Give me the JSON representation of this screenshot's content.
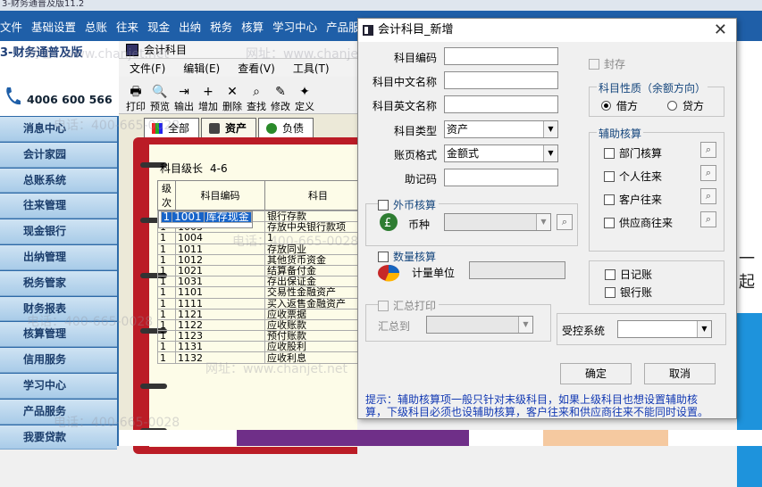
{
  "app": {
    "title": "3-财务通普及版11.2"
  },
  "menubar": [
    "文件",
    "基础设置",
    "总账",
    "往来",
    "现金",
    "出纳",
    "税务",
    "核算",
    "学习中心",
    "产品服务",
    "工"
  ],
  "brand": {
    "name": "3-财务通普及版",
    "phone": "4006 600 566"
  },
  "nav": [
    "消息中心",
    "会计家园",
    "总账系统",
    "往来管理",
    "现金银行",
    "出纳管理",
    "税务管家",
    "财务报表",
    "核算管理",
    "信用服务",
    "学习中心",
    "产品服务",
    "我要贷款"
  ],
  "bgwin": {
    "title": "会计科目",
    "menu": [
      "文件(F)",
      "编辑(E)",
      "查看(V)",
      "工具(T)"
    ],
    "toolbar": [
      {
        "label": "打印",
        "icon": "printer-icon",
        "glyph": "🖶"
      },
      {
        "label": "预览",
        "icon": "preview-icon",
        "glyph": "🔍"
      },
      {
        "label": "输出",
        "icon": "export-icon",
        "glyph": "⇥"
      },
      {
        "label": "增加",
        "icon": "add-icon",
        "glyph": "+"
      },
      {
        "label": "删除",
        "icon": "delete-icon",
        "glyph": "✕"
      },
      {
        "label": "查找",
        "icon": "find-icon",
        "glyph": "⌕"
      },
      {
        "label": "修改",
        "icon": "edit-icon",
        "glyph": "✎"
      },
      {
        "label": "定义",
        "icon": "define-icon",
        "glyph": "✦"
      }
    ],
    "tabs": [
      "全部",
      "资产",
      "负债"
    ],
    "level_label": "科目级长",
    "level_value": "4-6",
    "columns": [
      "级次",
      "科目编码",
      "科目"
    ],
    "rows": [
      {
        "lvl": "1",
        "code": "1001",
        "name": "库存现金",
        "selected": true
      },
      {
        "lvl": "1",
        "code": "1002",
        "name": "银行存款"
      },
      {
        "lvl": "1",
        "code": "1003",
        "name": "存放中央银行款项"
      },
      {
        "lvl": "1",
        "code": "1004",
        "name": "1"
      },
      {
        "lvl": "1",
        "code": "1011",
        "name": "存放同业"
      },
      {
        "lvl": "1",
        "code": "1012",
        "name": "其他货币资金"
      },
      {
        "lvl": "1",
        "code": "1021",
        "name": "结算备付金"
      },
      {
        "lvl": "1",
        "code": "1031",
        "name": "存出保证金"
      },
      {
        "lvl": "1",
        "code": "1101",
        "name": "交易性金融资产"
      },
      {
        "lvl": "1",
        "code": "1111",
        "name": "买入返售金融资产"
      },
      {
        "lvl": "1",
        "code": "1121",
        "name": "应收票据"
      },
      {
        "lvl": "1",
        "code": "1122",
        "name": "应收账款"
      },
      {
        "lvl": "1",
        "code": "1123",
        "name": "预付账款"
      },
      {
        "lvl": "1",
        "code": "1131",
        "name": "应收股利"
      },
      {
        "lvl": "1",
        "code": "1132",
        "name": "应收利息"
      }
    ]
  },
  "dialog": {
    "title": "会计科目_新增",
    "fields": {
      "code": {
        "label": "科目编码",
        "value": ""
      },
      "cn_name": {
        "label": "科目中文名称",
        "value": ""
      },
      "en_name": {
        "label": "科目英文名称",
        "value": ""
      },
      "type": {
        "label": "科目类型",
        "value": "资产"
      },
      "format": {
        "label": "账页格式",
        "value": "金额式"
      },
      "mnemonic": {
        "label": "助记码",
        "value": ""
      }
    },
    "sealed": "封存",
    "nature": {
      "legend": "科目性质（余额方向）",
      "debit": "借方",
      "credit": "贷方",
      "selected": "debit"
    },
    "aux": {
      "legend": "辅助核算",
      "items": [
        "部门核算",
        "个人往来",
        "客户往来",
        "供应商往来"
      ]
    },
    "journal": [
      "日记账",
      "银行账"
    ],
    "foreign": {
      "check": "外币核算",
      "currency_label": "币种",
      "currency_value": ""
    },
    "quantity": {
      "check": "数量核算",
      "unit_label": "计量单位",
      "unit_value": ""
    },
    "summary": {
      "check": "汇总打印",
      "to_label": "汇总到",
      "to_value": ""
    },
    "controlled": {
      "label": "受控系统",
      "value": ""
    },
    "ok": "确定",
    "cancel": "取消",
    "hint": "提示：辅助核算项一般只针对末级科目，如果上级科目也想设置辅助核算，下级科目必须也设辅助核算，客户往来和供应商往来不能同时设置。"
  },
  "bg_right": {
    "text": "一起"
  },
  "watermark": {
    "phone": "电话：400-665-0028",
    "url": "网址：www.chanjet.net"
  },
  "colors": {
    "menubar": "#1f5fa8",
    "nav": "#2d6aa8",
    "selection": "#1663c8",
    "notebook": "#bb1c26"
  }
}
